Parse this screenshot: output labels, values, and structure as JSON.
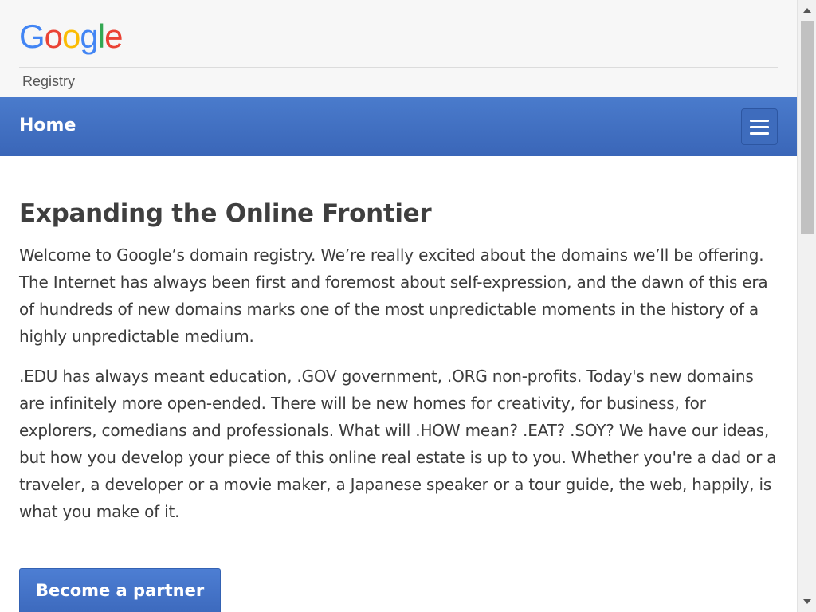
{
  "header": {
    "logo_letters": [
      {
        "char": "G",
        "color": "#4285F4"
      },
      {
        "char": "o",
        "color": "#EA4335"
      },
      {
        "char": "o",
        "color": "#FBBC05"
      },
      {
        "char": "g",
        "color": "#4285F4"
      },
      {
        "char": "l",
        "color": "#34A853"
      },
      {
        "char": "e",
        "color": "#EA4335"
      }
    ],
    "registry_label": "Registry"
  },
  "nav": {
    "home_label": "Home",
    "menu_icon": "hamburger-menu-icon",
    "bar_color": "#3f6fc2"
  },
  "main": {
    "headline": "Expanding the Online Frontier",
    "paragraph1": "Welcome to Google’s domain registry. We’re really excited about the domains we’ll be offering. The Internet has always been first and foremost about self-expression, and the dawn of this era of hundreds of new domains marks one of the most unpredictable moments in the history of a highly unpredictable medium.",
    "paragraph2": ".EDU has always meant education, .GOV government, .ORG non-profits. Today's new domains are infinitely more open-ended. There will be new homes for creativity, for business, for explorers, comedians and professionals. What will .HOW mean? .EAT? .SOY? We have our ideas, but how you develop your piece of this online real estate is up to you. Whether you're a dad or a traveler, a developer or a movie maker, a Japanese speaker or a tour guide, the web, happily, is what you make of it.",
    "partner_button_label": "Become a partner"
  },
  "scrollbar": {
    "up_icon": "scroll-up-arrow-icon",
    "down_icon": "scroll-down-arrow-icon"
  }
}
